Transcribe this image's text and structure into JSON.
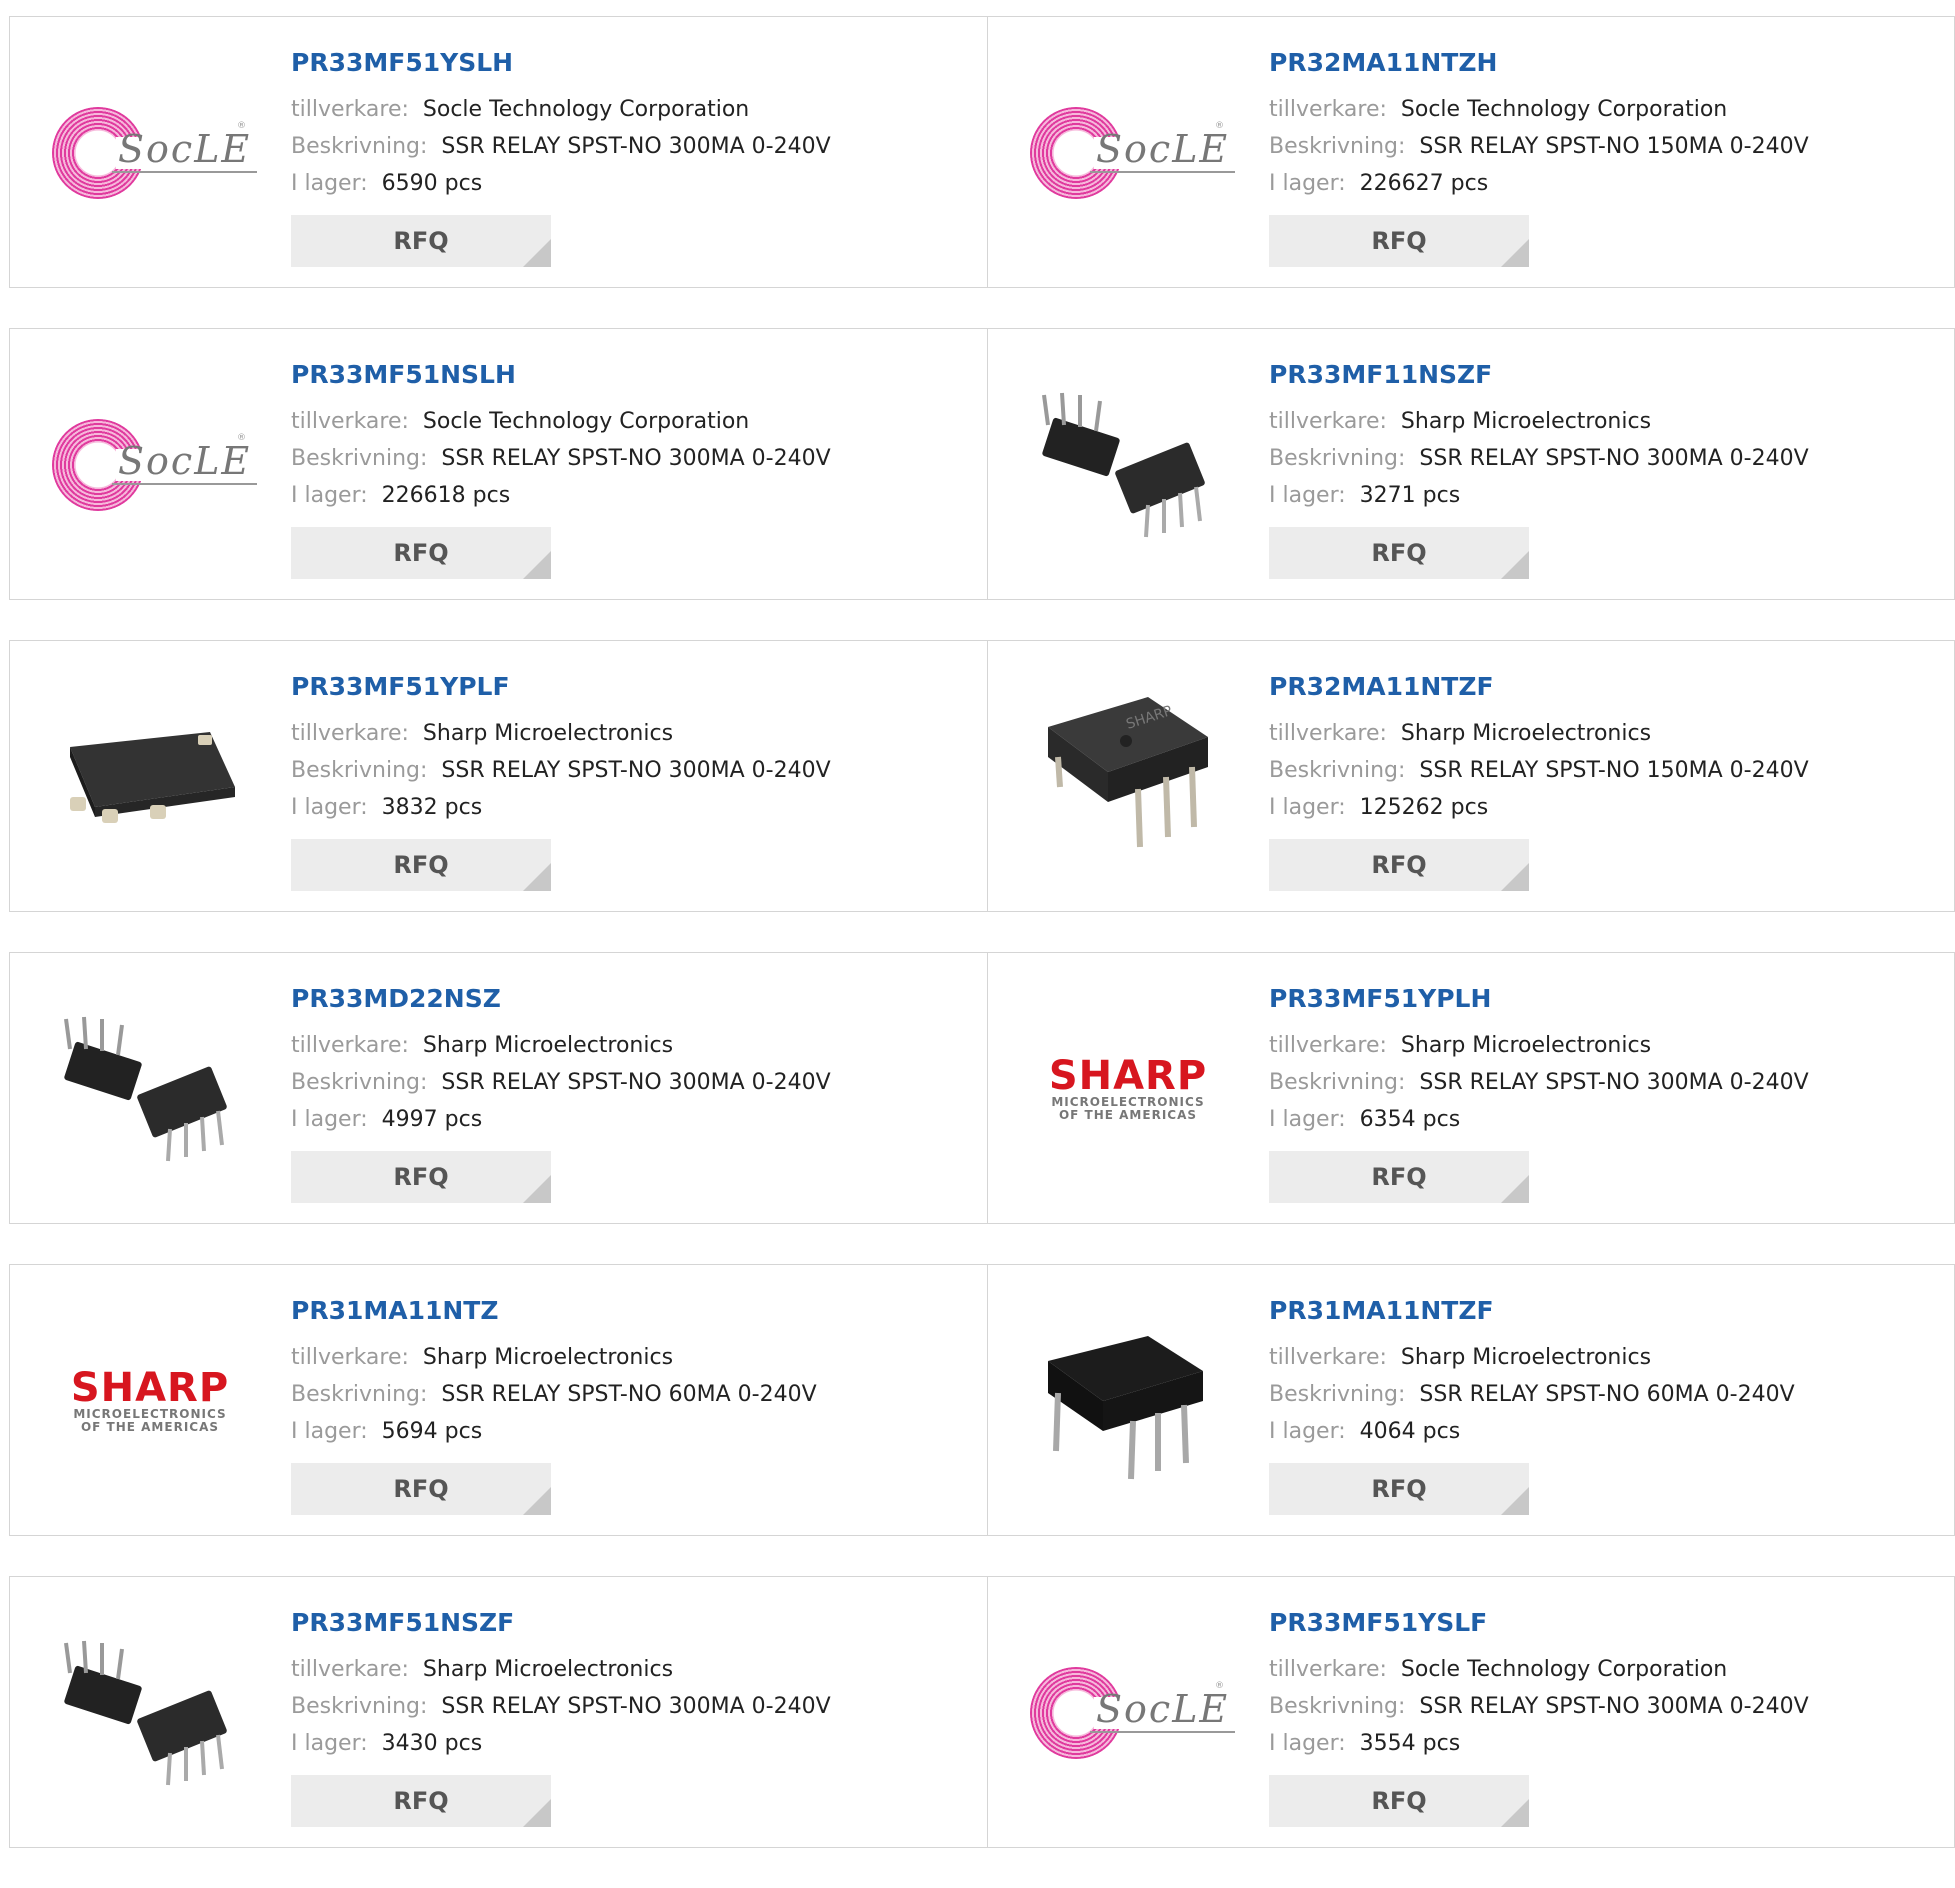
{
  "labels": {
    "manufacturer": "tillverkare:",
    "description": "Beskrivning:",
    "stock": "I lager:",
    "rfq": "RFQ"
  },
  "products": [
    {
      "part": "PR33MF51YSLH",
      "manufacturer": "Socle Technology Corporation",
      "description": "SSR RELAY SPST-NO 300MA 0-240V",
      "stock": "6590 pcs",
      "image": "socle-logo"
    },
    {
      "part": "PR32MA11NTZH",
      "manufacturer": "Socle Technology Corporation",
      "description": "SSR RELAY SPST-NO 150MA 0-240V",
      "stock": "226627 pcs",
      "image": "socle-logo"
    },
    {
      "part": "PR33MF51NSLH",
      "manufacturer": "Socle Technology Corporation",
      "description": "SSR RELAY SPST-NO 300MA 0-240V",
      "stock": "226618 pcs",
      "image": "socle-logo"
    },
    {
      "part": "PR33MF11NSZF",
      "manufacturer": "Sharp Microelectronics",
      "description": "SSR RELAY SPST-NO 300MA 0-240V",
      "stock": "3271 pcs",
      "image": "dip-pair-photo"
    },
    {
      "part": "PR33MF51YPLF",
      "manufacturer": "Sharp Microelectronics",
      "description": "SSR RELAY SPST-NO 300MA 0-240V",
      "stock": "3832 pcs",
      "image": "smd-photo"
    },
    {
      "part": "PR32MA11NTZF",
      "manufacturer": "Sharp Microelectronics",
      "description": "SSR RELAY SPST-NO 150MA 0-240V",
      "stock": "125262 pcs",
      "image": "dip-sharp-photo"
    },
    {
      "part": "PR33MD22NSZ",
      "manufacturer": "Sharp Microelectronics",
      "description": "SSR RELAY SPST-NO 300MA 0-240V",
      "stock": "4997 pcs",
      "image": "dip-pair-photo"
    },
    {
      "part": "PR33MF51YPLH",
      "manufacturer": "Sharp Microelectronics",
      "description": "SSR RELAY SPST-NO 300MA 0-240V",
      "stock": "6354 pcs",
      "image": "sharp-logo"
    },
    {
      "part": "PR31MA11NTZ",
      "manufacturer": "Sharp Microelectronics",
      "description": "SSR RELAY SPST-NO 60MA 0-240V",
      "stock": "5694 pcs",
      "image": "sharp-logo"
    },
    {
      "part": "PR31MA11NTZF",
      "manufacturer": "Sharp Microelectronics",
      "description": "SSR RELAY SPST-NO 60MA 0-240V",
      "stock": "4064 pcs",
      "image": "dip-black-photo"
    },
    {
      "part": "PR33MF51NSZF",
      "manufacturer": "Sharp Microelectronics",
      "description": "SSR RELAY SPST-NO 300MA 0-240V",
      "stock": "3430 pcs",
      "image": "dip-pair-photo"
    },
    {
      "part": "PR33MF51YSLF",
      "manufacturer": "Socle Technology Corporation",
      "description": "SSR RELAY SPST-NO 300MA 0-240V",
      "stock": "3554 pcs",
      "image": "socle-logo"
    }
  ],
  "logos": {
    "socle_word": "SocLE",
    "sharp_word": "SHARP",
    "sharp_sub1": "MICROELECTRONICS",
    "sharp_sub2": "OF THE AMERICAS",
    "chip_print": "SHARP"
  },
  "colors": {
    "link": "#1f5fa8",
    "label": "#9a9a9a",
    "button_bg": "#ececec",
    "border": "#d5d5d5",
    "sharp_red": "#d7161f",
    "socle_pink": "#e03a9e"
  }
}
